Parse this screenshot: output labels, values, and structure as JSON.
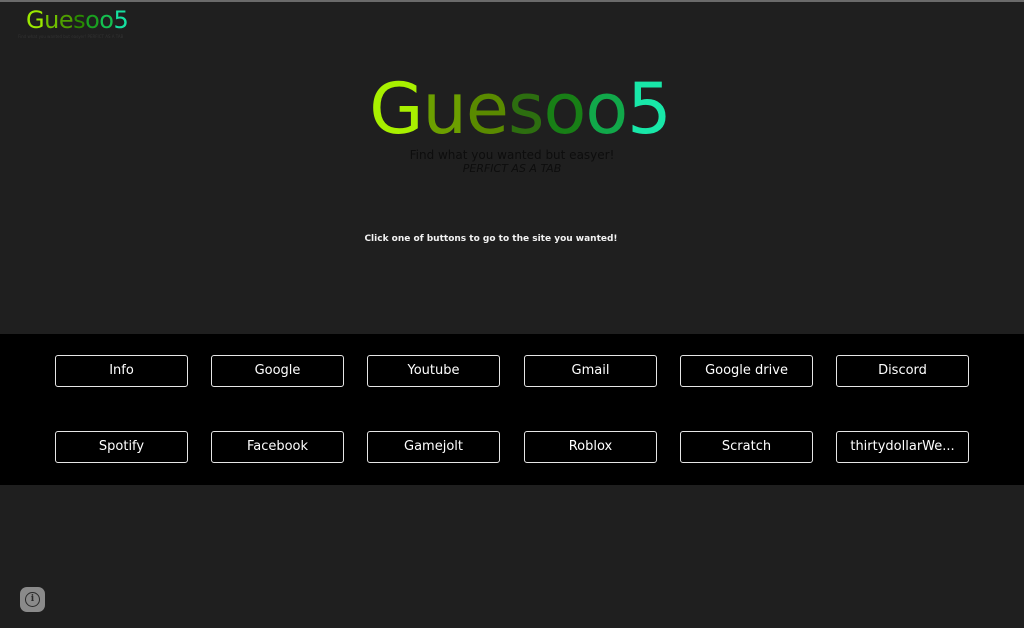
{
  "mini_logo": {
    "letters": [
      "G",
      "u",
      "e",
      "s",
      "o",
      "o",
      "5"
    ],
    "colors": [
      "#9be800",
      "#6fbf00",
      "#4f9f00",
      "#2a8a00",
      "#1aa020",
      "#14c050",
      "#16e0a0"
    ],
    "subtext": "Find what you wanted but easyer! PERFICT AS A TAB"
  },
  "hero": {
    "letters": [
      "G",
      "u",
      "e",
      "s",
      "o",
      "o",
      "5"
    ],
    "colors": [
      "#a8f000",
      "#6c9f00",
      "#5a8a00",
      "#2d6e10",
      "#187f16",
      "#11a84a",
      "#18e7a8"
    ],
    "tagline": "Find what you wanted but easyer!",
    "tagline2": "PERFICT AS A TAB"
  },
  "instruction": "Click one of buttons to go to the site you wanted!",
  "buttons": [
    {
      "label": "Info"
    },
    {
      "label": "Google"
    },
    {
      "label": "Youtube"
    },
    {
      "label": "Gmail"
    },
    {
      "label": "Google drive"
    },
    {
      "label": "Discord"
    },
    {
      "label": "Spotify"
    },
    {
      "label": "Facebook"
    },
    {
      "label": "Gamejolt"
    },
    {
      "label": "Roblox"
    },
    {
      "label": "Scratch"
    },
    {
      "label": "thirtydollarWe..."
    }
  ],
  "info_fab": {
    "icon": "info-icon",
    "glyph": "i"
  }
}
